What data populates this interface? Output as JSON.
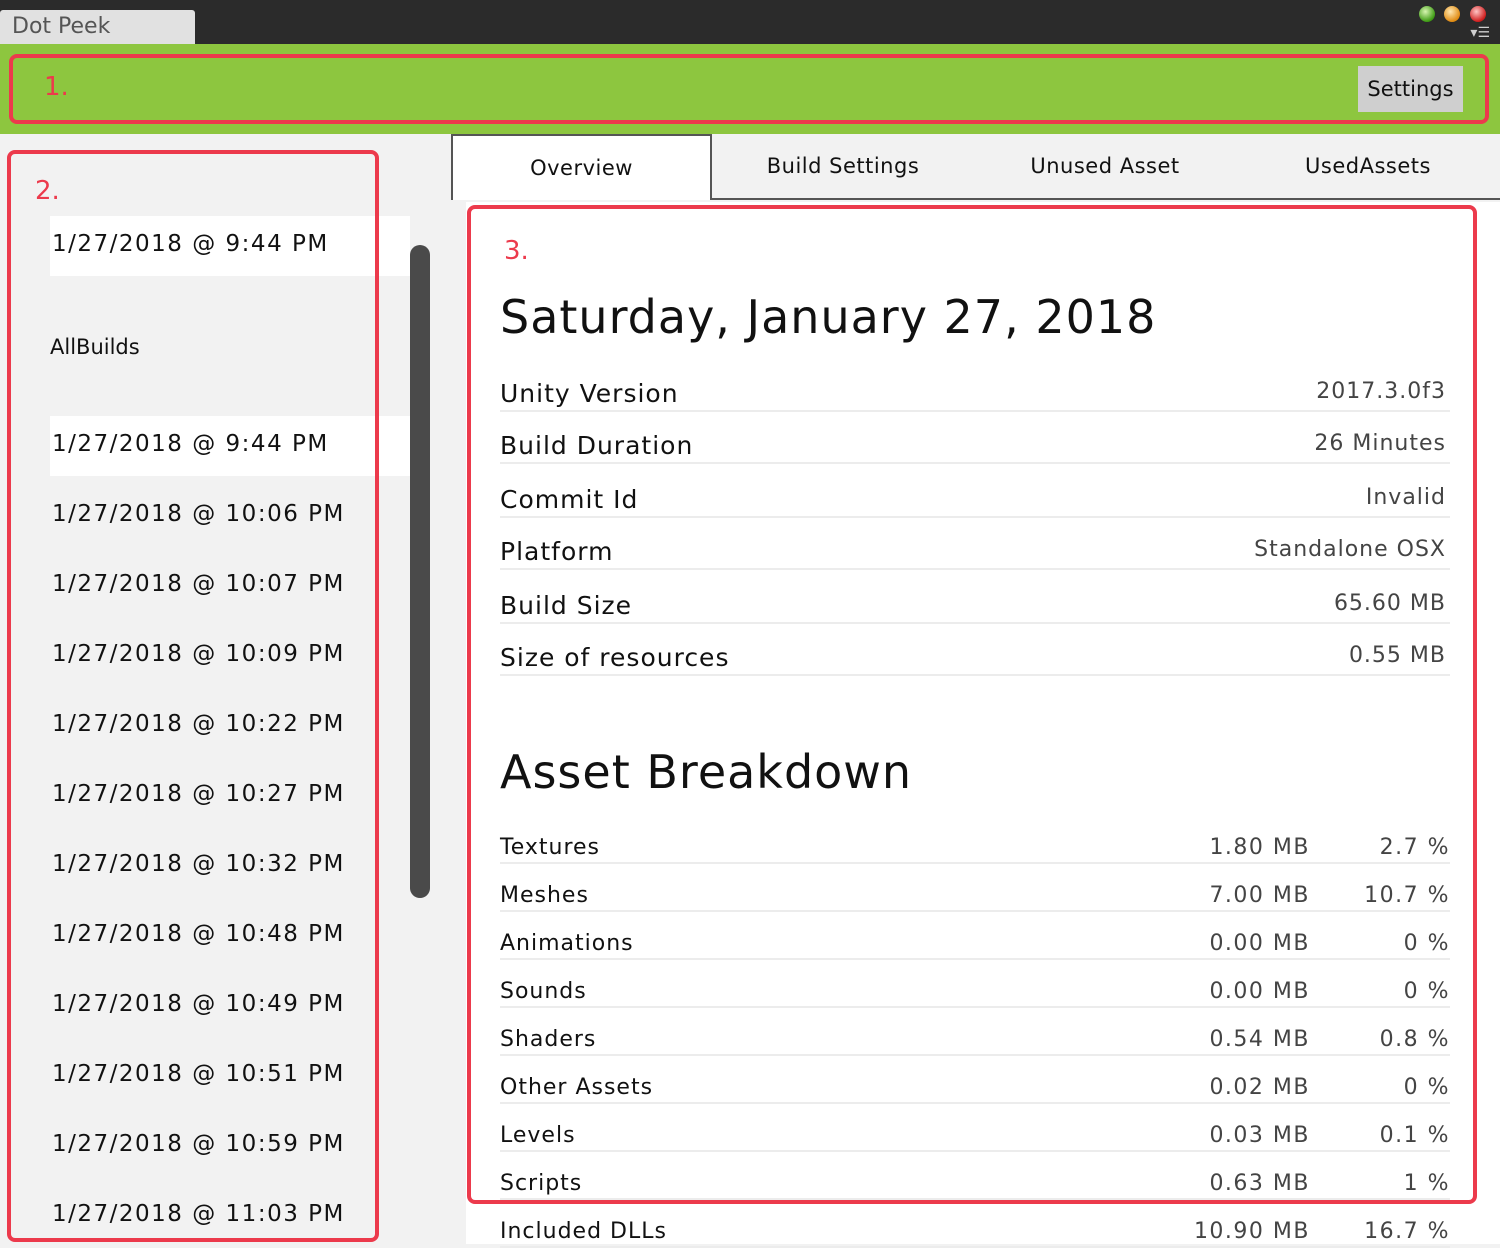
{
  "window": {
    "title": "Dot Peek",
    "menu_glyph": "▾☰"
  },
  "topbar": {
    "settings_label": "Settings"
  },
  "annotations": [
    "1.",
    "2.",
    "3."
  ],
  "sidebar": {
    "current_build": "1/27/2018 @ 9:44 PM",
    "section_label": "AllBuilds",
    "builds": [
      "1/27/2018 @ 9:44 PM",
      "1/27/2018 @ 10:06 PM",
      "1/27/2018 @ 10:07 PM",
      "1/27/2018 @ 10:09 PM",
      "1/27/2018 @ 10:22 PM",
      "1/27/2018 @ 10:27 PM",
      "1/27/2018 @ 10:32 PM",
      "1/27/2018 @ 10:48 PM",
      "1/27/2018 @ 10:49 PM",
      "1/27/2018 @ 10:51 PM",
      "1/27/2018 @ 10:59 PM",
      "1/27/2018 @ 11:03 PM"
    ]
  },
  "tabs": [
    {
      "label": "Overview",
      "active": true
    },
    {
      "label": "Build Settings",
      "active": false
    },
    {
      "label": "Unused Asset",
      "active": false
    },
    {
      "label": "UsedAssets",
      "active": false
    }
  ],
  "overview": {
    "date_title": "Saturday, January 27, 2018",
    "info": [
      {
        "key": "Unity Version",
        "value": "2017.3.0f3"
      },
      {
        "key": "Build Duration",
        "value": "26 Minutes"
      },
      {
        "key": "Commit Id",
        "value": "Invalid"
      },
      {
        "key": "Platform",
        "value": "Standalone OSX"
      },
      {
        "key": "Build Size",
        "value": "65.60 MB"
      },
      {
        "key": "Size of resources",
        "value": "0.55 MB"
      }
    ],
    "asset_title": "Asset Breakdown",
    "assets": [
      {
        "name": "Textures",
        "size": "1.80 MB",
        "percent": "2.7 %"
      },
      {
        "name": "Meshes",
        "size": "7.00 MB",
        "percent": "10.7 %"
      },
      {
        "name": "Animations",
        "size": "0.00 MB",
        "percent": "0 %"
      },
      {
        "name": "Sounds",
        "size": "0.00 MB",
        "percent": "0 %"
      },
      {
        "name": "Shaders",
        "size": "0.54 MB",
        "percent": "0.8 %"
      },
      {
        "name": "Other Assets",
        "size": "0.02 MB",
        "percent": "0 %"
      },
      {
        "name": "Levels",
        "size": "0.03 MB",
        "percent": "0.1 %"
      },
      {
        "name": "Scripts",
        "size": "0.63 MB",
        "percent": "1 %"
      },
      {
        "name": "Included DLLs",
        "size": "10.90 MB",
        "percent": "16.7 %"
      }
    ]
  },
  "colors": {
    "topbar": "#8dc63f",
    "annotation": "#ec3a4c",
    "titlebar": "#2b2b2b"
  }
}
